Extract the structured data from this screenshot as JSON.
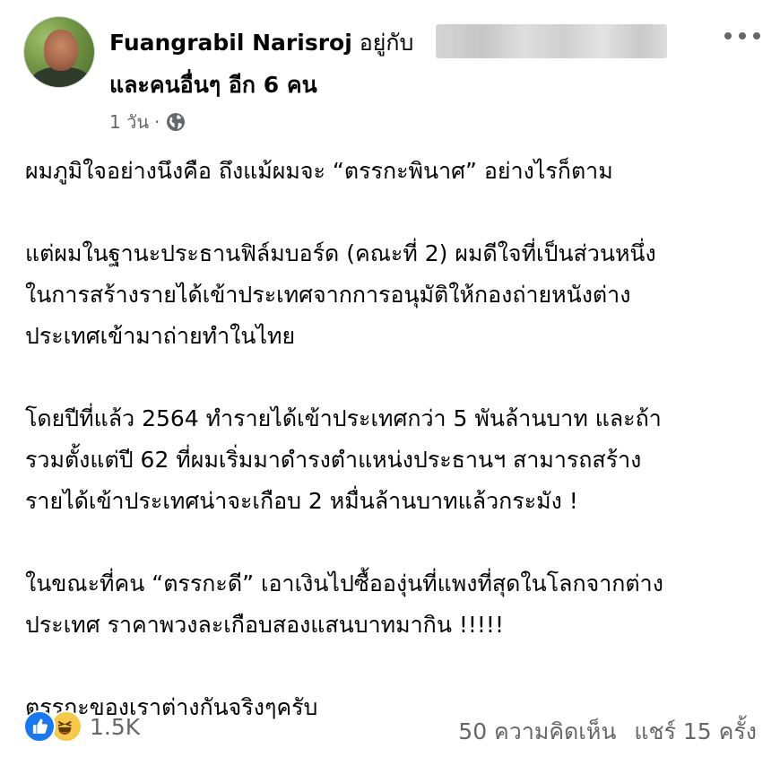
{
  "post": {
    "author": "Fuangrabil Narisroj",
    "with_text": "อยู่กับ",
    "others_text": "และคนอื่นๆ อีก 6 คน",
    "time": "1 วัน",
    "separator": "·",
    "privacy_icon": "globe-icon",
    "more_icon": "more-icon"
  },
  "content": {
    "p1": [
      "ผมภูมิใจอย่างนึงคือ ถึงแม้ผมจะ “ตรรกะพินาศ” อย่างไรก็ตาม"
    ],
    "p2": [
      "แต่ผมในฐานะประธานฟิล์มบอร์ด (คณะที่ 2) ผมดีใจที่เป็นส่วนหนึ่ง",
      "ในการสร้างรายได้เข้าประเทศจากการอนุมัติให้กองถ่ายหนังต่าง",
      "ประเทศเข้ามาถ่ายทำในไทย"
    ],
    "p3": [
      "โดยปีที่แล้ว 2564 ทำรายได้เข้าประเทศกว่า 5 พันล้านบาท และถ้า",
      "รวมตั้งแต่ปี 62 ที่ผมเริ่มมาดำรงตำแหน่งประธานฯ สามารถสร้าง",
      "รายได้เข้าประเทศน่าจะเกือบ 2 หมื่นล้านบาทแล้วกระมัง !"
    ],
    "p4": [
      "ในขณะที่คน “ตรรกะดี” เอาเงินไปซื้อองุ่นที่แพงที่สุดในโลกจากต่าง",
      "ประเทศ ราคาพวงละเกือบสองแสนบาทมากิน !!!!!"
    ],
    "p5": [
      "ตรรกะของเราต่างกันจริงๆครับ"
    ]
  },
  "footer": {
    "reaction_count": "1.5K",
    "comments": "50 ความคิดเห็น",
    "shares": "แชร์ 15 ครั้ง",
    "reaction_icons": [
      "like-icon",
      "haha-icon"
    ]
  },
  "colors": {
    "text": "#050505",
    "secondary": "#65676b",
    "like_blue": "#1877f2",
    "haha_yellow": "#f7c948"
  }
}
